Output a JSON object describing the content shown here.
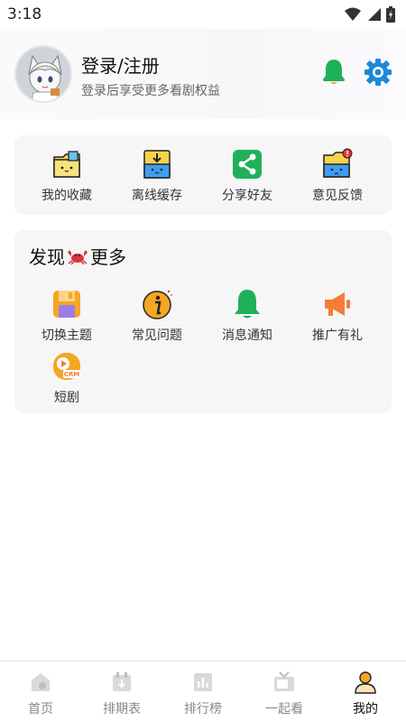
{
  "status_bar": {
    "time": "3:18"
  },
  "profile": {
    "title": "登录/注册",
    "subtitle": "登录后享受更多看剧权益"
  },
  "quick_actions": [
    {
      "label": "我的收藏",
      "icon": "folder-star-icon"
    },
    {
      "label": "离线缓存",
      "icon": "download-icon"
    },
    {
      "label": "分享好友",
      "icon": "share-icon"
    },
    {
      "label": "意见反馈",
      "icon": "feedback-folder-icon"
    }
  ],
  "discover": {
    "title_left": "发现",
    "title_right": "更多",
    "items": [
      {
        "label": "切换主题",
        "icon": "theme-icon"
      },
      {
        "label": "常见问题",
        "icon": "info-icon"
      },
      {
        "label": "消息通知",
        "icon": "bell-icon"
      },
      {
        "label": "推广有礼",
        "icon": "megaphone-icon"
      },
      {
        "label": "短剧",
        "icon": "crm-play-icon",
        "badge": "CRM"
      }
    ]
  },
  "tabs": [
    {
      "label": "首页",
      "icon": "home-icon",
      "active": false
    },
    {
      "label": "排期表",
      "icon": "calendar-icon",
      "active": false
    },
    {
      "label": "排行榜",
      "icon": "ranking-icon",
      "active": false
    },
    {
      "label": "一起看",
      "icon": "tv-icon",
      "active": false
    },
    {
      "label": "我的",
      "icon": "profile-icon",
      "active": true
    }
  ],
  "colors": {
    "accent_green": "#1fb15a",
    "gear_blue": "#1e88d8",
    "orange": "#f5a623",
    "card_bg": "#f6f6f7"
  }
}
